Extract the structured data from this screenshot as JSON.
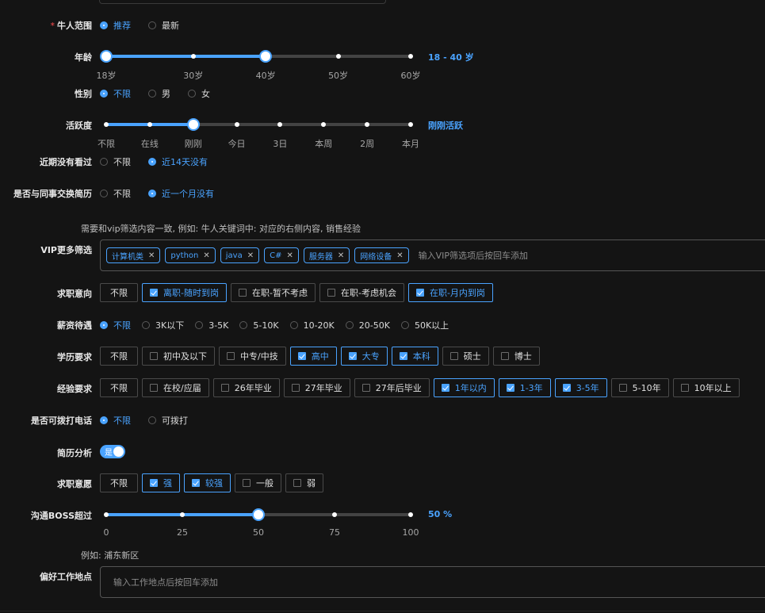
{
  "range": {
    "label": "牛人范围",
    "options": [
      "推荐",
      "最新"
    ],
    "selected": 0
  },
  "age": {
    "label": "年龄",
    "value_text": "18 - 40 岁",
    "ticks": [
      "18岁",
      "30岁",
      "40岁",
      "50岁",
      "60岁"
    ],
    "min": 18,
    "max": 60,
    "low": 18,
    "high": 40
  },
  "gender": {
    "label": "性别",
    "options": [
      "不限",
      "男",
      "女"
    ],
    "selected": 0
  },
  "activity": {
    "label": "活跃度",
    "value_text": "刚刚活跃",
    "ticks": [
      "不限",
      "在线",
      "刚刚",
      "今日",
      "3日",
      "本周",
      "2周",
      "本月"
    ],
    "selected_index": 2
  },
  "recent_viewed": {
    "label": "近期没有看过",
    "options": [
      "不限",
      "近14天没有"
    ],
    "selected": 1
  },
  "colleague_exchange": {
    "label": "是否与同事交换简历",
    "options": [
      "不限",
      "近一个月没有"
    ],
    "selected": 1
  },
  "vip": {
    "hint": "需要和vip筛选内容一致, 例如: 牛人关键词中: 对应的右侧内容, 销售经验",
    "label": "VIP更多筛选",
    "tags": [
      "计算机类",
      "python",
      "java",
      "C#",
      "服务器",
      "网络设备"
    ],
    "placeholder": "输入VIP筛选项后按回车添加"
  },
  "job_intent": {
    "label": "求职意向",
    "options": [
      {
        "text": "不限",
        "checkbox": false,
        "checked": false
      },
      {
        "text": "离职-随时到岗",
        "checkbox": true,
        "checked": true
      },
      {
        "text": "在职-暂不考虑",
        "checkbox": true,
        "checked": false
      },
      {
        "text": "在职-考虑机会",
        "checkbox": true,
        "checked": false
      },
      {
        "text": "在职-月内到岗",
        "checkbox": true,
        "checked": true
      }
    ]
  },
  "salary": {
    "label": "薪资待遇",
    "options": [
      "不限",
      "3K以下",
      "3-5K",
      "5-10K",
      "10-20K",
      "20-50K",
      "50K以上"
    ],
    "selected": 0
  },
  "education": {
    "label": "学历要求",
    "options": [
      {
        "text": "不限",
        "checkbox": false,
        "checked": false
      },
      {
        "text": "初中及以下",
        "checkbox": true,
        "checked": false
      },
      {
        "text": "中专/中技",
        "checkbox": true,
        "checked": false
      },
      {
        "text": "高中",
        "checkbox": true,
        "checked": true
      },
      {
        "text": "大专",
        "checkbox": true,
        "checked": true
      },
      {
        "text": "本科",
        "checkbox": true,
        "checked": true
      },
      {
        "text": "硕士",
        "checkbox": true,
        "checked": false
      },
      {
        "text": "博士",
        "checkbox": true,
        "checked": false
      }
    ]
  },
  "experience": {
    "label": "经验要求",
    "options": [
      {
        "text": "不限",
        "checkbox": false,
        "checked": false
      },
      {
        "text": "在校/应届",
        "checkbox": true,
        "checked": false
      },
      {
        "text": "26年毕业",
        "checkbox": true,
        "checked": false
      },
      {
        "text": "27年毕业",
        "checkbox": true,
        "checked": false
      },
      {
        "text": "27年后毕业",
        "checkbox": true,
        "checked": false
      },
      {
        "text": "1年以内",
        "checkbox": true,
        "checked": true
      },
      {
        "text": "1-3年",
        "checkbox": true,
        "checked": true
      },
      {
        "text": "3-5年",
        "checkbox": true,
        "checked": true
      },
      {
        "text": "5-10年",
        "checkbox": true,
        "checked": false
      },
      {
        "text": "10年以上",
        "checkbox": true,
        "checked": false
      }
    ]
  },
  "phone": {
    "label": "是否可拨打电话",
    "options": [
      "不限",
      "可拨打"
    ],
    "selected": 0
  },
  "resume_analysis": {
    "label": "简历分析",
    "switch_text": "是",
    "on": true
  },
  "job_willingness": {
    "label": "求职意愿",
    "options": [
      {
        "text": "不限",
        "checkbox": false,
        "checked": false
      },
      {
        "text": "强",
        "checkbox": true,
        "checked": true
      },
      {
        "text": "较强",
        "checkbox": true,
        "checked": true
      },
      {
        "text": "一般",
        "checkbox": true,
        "checked": false
      },
      {
        "text": "弱",
        "checkbox": true,
        "checked": false
      }
    ]
  },
  "boss_comm": {
    "label": "沟通BOSS超过",
    "value_text": "50 %",
    "ticks": [
      "0",
      "25",
      "50",
      "75",
      "100"
    ],
    "value": 50
  },
  "location": {
    "hint": "例如: 浦东新区",
    "label": "偏好工作地点",
    "placeholder": "输入工作地点后按回车添加"
  },
  "colors": {
    "accent": "#4aa3ff",
    "background": "#141414",
    "required": "#ff4d4f"
  }
}
